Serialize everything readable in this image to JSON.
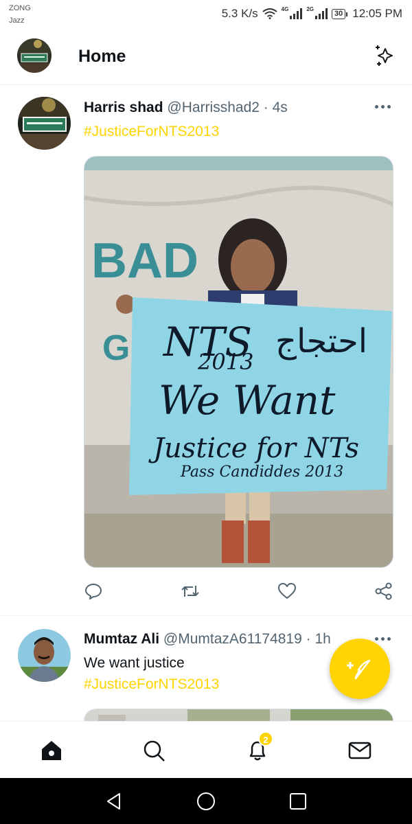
{
  "status_bar": {
    "carrier_1": "ZONG",
    "carrier_2": "Jazz",
    "speed": "5.3 K/s",
    "net_1": "4G",
    "net_2": "2G",
    "battery": "30",
    "time": "12:05 PM"
  },
  "header": {
    "title": "Home",
    "sparkle_icon": "sparkle-icon"
  },
  "tweets": [
    {
      "name": "Harris shad",
      "handle": "@Harrisshad2",
      "separator": "·",
      "time": "4s",
      "hashtag": "#JusticeForNTS2013",
      "media": {
        "sign_line_1": "NTS",
        "sign_line_1_urdu": "احتجاج",
        "sign_line_2": "2013",
        "sign_line_3": "We Want",
        "sign_line_4": "Justice for NTs",
        "sign_line_5": "Pass Candiddes 2013",
        "wall_text_1": "BAD",
        "wall_text_2": "G"
      }
    },
    {
      "name": "Mumtaz Ali",
      "handle": "@MumtazA61174819",
      "separator": "·",
      "time": "1h",
      "text": "We want justice",
      "hashtag": "#JusticeForNTS2013"
    }
  ],
  "actions": [
    "reply-icon",
    "retweet-icon",
    "like-icon",
    "share-icon"
  ],
  "bottom_nav": {
    "items": [
      "home-icon",
      "search-icon",
      "notifications-icon",
      "messages-icon"
    ],
    "notification_count": "2"
  },
  "colors": {
    "accent": "#ffd400",
    "text": "#0f1419",
    "secondary": "#536471",
    "sign_blue": "#8fd5e6"
  }
}
